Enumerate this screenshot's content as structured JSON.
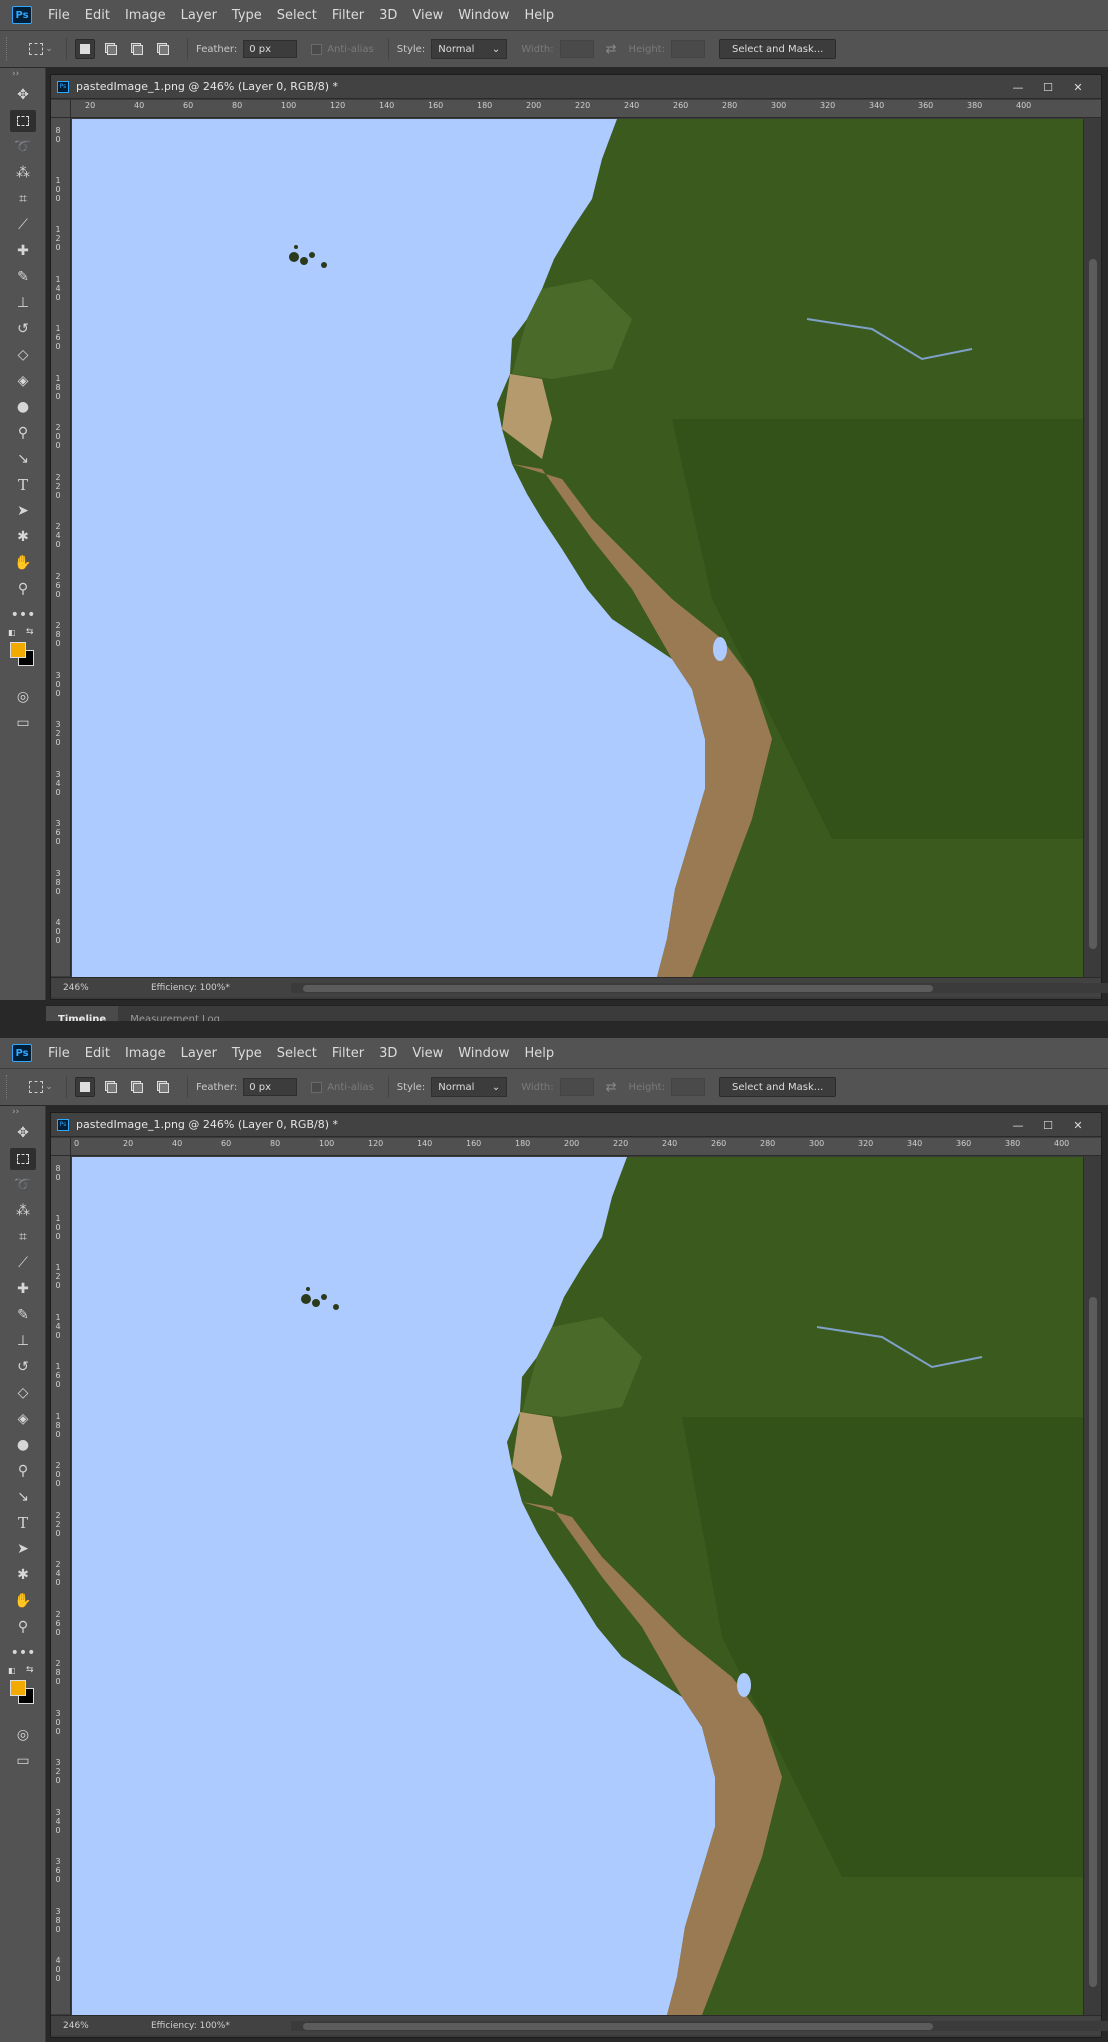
{
  "app": {
    "logo": "Ps"
  },
  "menu": [
    "File",
    "Edit",
    "Image",
    "Layer",
    "Type",
    "Select",
    "Filter",
    "3D",
    "View",
    "Window",
    "Help"
  ],
  "options": {
    "feather_label": "Feather:",
    "feather_value": "0 px",
    "antialias_label": "Anti-alias",
    "style_label": "Style:",
    "style_value": "Normal",
    "width_label": "Width:",
    "height_label": "Height:",
    "select_mask_label": "Select and Mask..."
  },
  "document": {
    "title": "pastedImage_1.png @ 246% (Layer 0, RGB/8) *",
    "zoom": "246%",
    "efficiency": "Efficiency: 100%*"
  },
  "ruler_top": {
    "top_instance": [
      "20",
      "40",
      "60",
      "80",
      "100",
      "120",
      "140",
      "160",
      "180",
      "200",
      "220",
      "240",
      "260",
      "280",
      "300",
      "320",
      "340",
      "360",
      "380",
      "400"
    ],
    "bottom_instance": [
      "0",
      "20",
      "40",
      "60",
      "80",
      "100",
      "120",
      "140",
      "160",
      "180",
      "200",
      "220",
      "240",
      "260",
      "280",
      "300",
      "320",
      "340",
      "360",
      "380",
      "400"
    ]
  },
  "ruler_left": {
    "top_instance": [
      "8\n0",
      "1\n0\n0",
      "1\n2\n0",
      "1\n4\n0",
      "1\n6\n0",
      "1\n8\n0",
      "2\n0\n0",
      "2\n2\n0",
      "2\n4\n0",
      "2\n6\n0",
      "2\n8\n0",
      "3\n0\n0",
      "3\n2\n0",
      "3\n4\n0",
      "3\n6\n0",
      "3\n8\n0",
      "4\n0\n0"
    ],
    "bottom_instance": [
      "8\n0",
      "1\n0\n0",
      "1\n2\n0",
      "1\n4\n0",
      "1\n6\n0",
      "1\n8\n0",
      "2\n0\n0",
      "2\n2\n0",
      "2\n4\n0",
      "2\n6\n0",
      "2\n8\n0",
      "3\n0\n0",
      "3\n2\n0",
      "3\n4\n0",
      "3\n6\n0",
      "3\n8\n0",
      "4\n0\n0"
    ]
  },
  "panel_tabs": [
    "Timeline",
    "Measurement Log"
  ],
  "tools": [
    "move-icon",
    "rect-marquee-icon",
    "lasso-icon",
    "magic-wand-icon",
    "crop-icon",
    "eyedropper-icon",
    "healing-brush-icon",
    "brush-icon",
    "clone-stamp-icon",
    "history-brush-icon",
    "eraser-icon",
    "paint-bucket-icon",
    "blur-icon",
    "dodge-icon",
    "pen-icon",
    "type-icon",
    "path-select-icon",
    "custom-shape-icon",
    "hand-icon",
    "zoom-icon",
    "more-tools-icon"
  ],
  "colors": {
    "foreground": "#f2a900",
    "background": "#000000",
    "ocean": "#aecbff",
    "accent": "#31a8ff"
  }
}
